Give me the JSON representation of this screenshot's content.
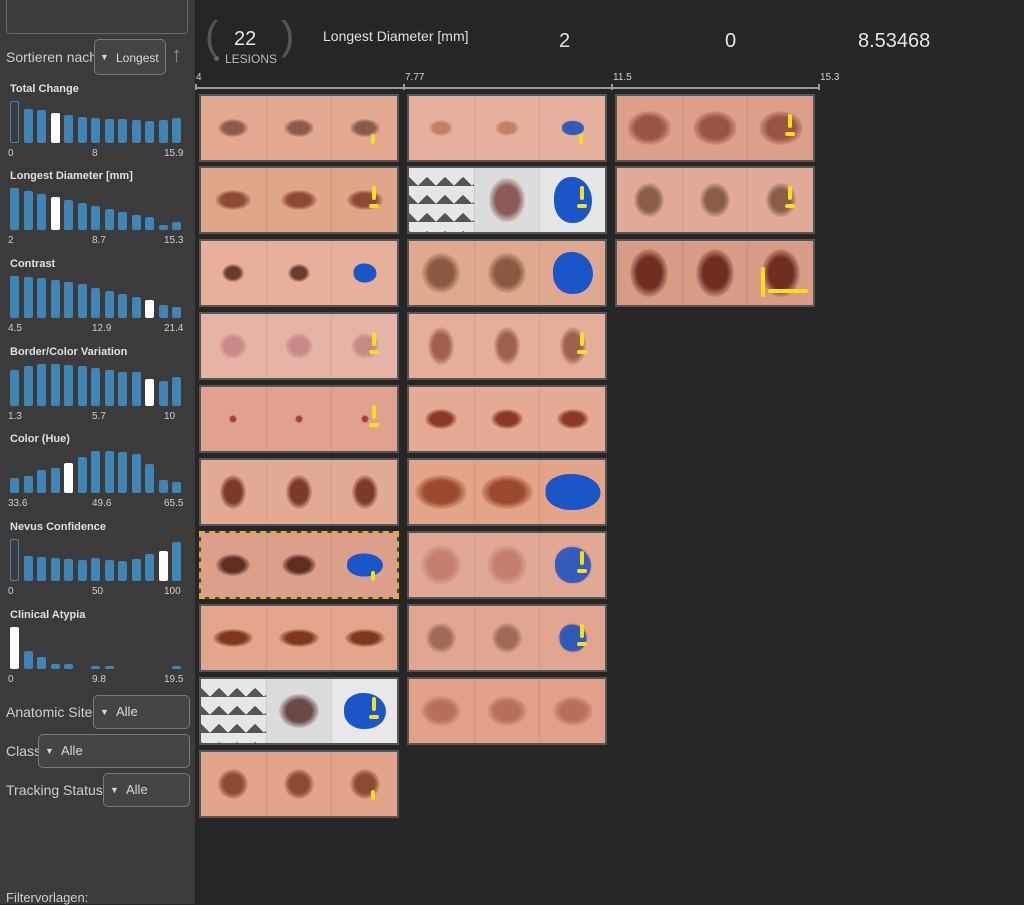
{
  "sidebar": {
    "sort_label": "Sortieren nach",
    "sort_value": "Longest",
    "sort_direction_icon": "arrow-up-icon",
    "histograms": [
      {
        "title": "Total Change",
        "ticks": [
          "0",
          "8",
          "15.9"
        ],
        "bars": [
          1.0,
          0.82,
          0.78,
          0.72,
          0.66,
          0.62,
          0.6,
          0.58,
          0.56,
          0.54,
          0.52,
          0.55,
          0.6
        ],
        "highlight": 3,
        "outline": 0
      },
      {
        "title": "Longest Diameter [mm]",
        "ticks": [
          "2",
          "8.7",
          "15.3"
        ],
        "bars": [
          1.0,
          0.92,
          0.85,
          0.78,
          0.72,
          0.65,
          0.58,
          0.5,
          0.42,
          0.35,
          0.3,
          0.12,
          0.18
        ],
        "highlight": 3,
        "outline": -1
      },
      {
        "title": "Contrast",
        "ticks": [
          "4.5",
          "12.9",
          "21.4"
        ],
        "bars": [
          1.0,
          0.98,
          0.95,
          0.9,
          0.85,
          0.8,
          0.72,
          0.65,
          0.58,
          0.5,
          0.42,
          0.32,
          0.25
        ],
        "highlight": 10,
        "outline": -1
      },
      {
        "title": "Border/Color Variation",
        "ticks": [
          "1.3",
          "5.7",
          "10"
        ],
        "bars": [
          0.85,
          0.95,
          1.0,
          1.0,
          0.98,
          0.95,
          0.9,
          0.85,
          0.82,
          0.8,
          0.65,
          0.6,
          0.7
        ],
        "highlight": 10,
        "outline": -1
      },
      {
        "title": "Color (Hue)",
        "ticks": [
          "33.6",
          "49.6",
          "65.5"
        ],
        "bars": [
          0.35,
          0.4,
          0.55,
          0.6,
          0.72,
          0.85,
          1.0,
          1.0,
          0.98,
          0.92,
          0.7,
          0.3,
          0.25
        ],
        "highlight": 4,
        "outline": -1
      },
      {
        "title": "Nevus Confidence",
        "ticks": [
          "0",
          "50",
          "100"
        ],
        "bars": [
          1.0,
          0.6,
          0.58,
          0.55,
          0.52,
          0.5,
          0.55,
          0.5,
          0.48,
          0.52,
          0.65,
          0.72,
          0.92
        ],
        "highlight": 11,
        "outline": 0
      },
      {
        "title": "Clinical Atypia",
        "ticks": [
          "0",
          "9.8",
          "19.5"
        ],
        "bars": [
          1.0,
          0.42,
          0.28,
          0.12,
          0.12,
          0.0,
          0.08,
          0.08,
          0.0,
          0.0,
          0.0,
          0.0,
          0.08
        ],
        "highlight": 0,
        "outline": -1
      }
    ],
    "filters": [
      {
        "label": "Anatomic Site",
        "value": "Alle"
      },
      {
        "label": "Class",
        "value": "Alle"
      },
      {
        "label": "Tracking Status",
        "value": "Alle"
      }
    ],
    "filtervorlagen_label": "Filtervorlagen:"
  },
  "header": {
    "lesion_count": "22",
    "lesion_label": "LESIONS",
    "attribute": "Longest Diameter [mm]",
    "numbers": [
      "2",
      "0",
      "8.53468"
    ],
    "axis_ticks": [
      "4",
      "7.77",
      "11.5",
      "15.3"
    ]
  },
  "colors": {
    "background": "#262626",
    "sidebar": "#3b3b3b",
    "bar": "#3f86b6",
    "highlight": "#ffffff",
    "segmentation": "#1a56c8",
    "boundary": "#f4e020",
    "selection": "#e0b020"
  },
  "grid": {
    "columns": [
      [
        {
          "skin": "#e3a890",
          "lesion": "#8a5a4a",
          "size": [
            30,
            18
          ],
          "seg": 0,
          "y": 1
        },
        {
          "skin": "#e0a68a",
          "lesion": "#8d4a34",
          "size": [
            36,
            20
          ],
          "seg": 0,
          "y": 2
        },
        {
          "skin": "#e8b09a",
          "lesion": "#6b3a2e",
          "size": [
            22,
            18
          ],
          "seg": 1,
          "y": 0
        },
        {
          "skin": "#e6b4a6",
          "lesion": "#c88a86",
          "size": [
            28,
            26
          ],
          "seg": 0,
          "y": 2
        },
        {
          "skin": "#e0a28e",
          "lesion": "#a04040",
          "size": [
            8,
            8
          ],
          "seg": 0,
          "y": 2
        },
        {
          "skin": "#e2aa92",
          "lesion": "#7a3a26",
          "size": [
            26,
            34
          ],
          "seg": 0,
          "y": 0
        },
        {
          "skin": "#dca08a",
          "lesion": "#5e2e22",
          "size": [
            34,
            22
          ],
          "seg": 1,
          "y": 1,
          "selected": true
        },
        {
          "skin": "#e3a68c",
          "lesion": "#7e3820",
          "size": [
            40,
            18
          ],
          "seg": 0,
          "y": 0
        },
        {
          "skin": "#e8e8e8",
          "lesion": "#6a4a48",
          "size": [
            40,
            34
          ],
          "seg": 1,
          "y": 2,
          "pattern": true
        },
        {
          "skin": "#e2a48a",
          "lesion": "#8a4a34",
          "size": [
            30,
            30
          ],
          "seg": 0,
          "y": 1
        }
      ],
      [
        {
          "skin": "#e6b09c",
          "lesion": "#c47e62",
          "size": [
            24,
            16
          ],
          "seg": 2,
          "y": 1
        },
        {
          "skin": "#e6e6e6",
          "lesion": "#8a5a5a",
          "size": [
            36,
            44
          ],
          "seg": 1,
          "y": 2,
          "pattern": true
        },
        {
          "skin": "#e0a88e",
          "lesion": "#8a5a40",
          "size": [
            38,
            40
          ],
          "seg": 1,
          "y": 0
        },
        {
          "skin": "#e4ae98",
          "lesion": "#a0604e",
          "size": [
            26,
            38
          ],
          "seg": 0,
          "y": 2
        },
        {
          "skin": "#e4aa94",
          "lesion": "#8a3a22",
          "size": [
            32,
            20
          ],
          "seg": 0,
          "y": 0
        },
        {
          "skin": "#e4a48a",
          "lesion": "#9a4a2e",
          "size": [
            52,
            34
          ],
          "seg": 1,
          "y": 0
        },
        {
          "skin": "#e2a896",
          "lesion": "#c4806e",
          "size": [
            40,
            40
          ],
          "seg": 2,
          "y": 2
        },
        {
          "skin": "#e0a690",
          "lesion": "#a06a58",
          "size": [
            30,
            30
          ],
          "seg": 2,
          "y": 2
        },
        {
          "skin": "#e2a088",
          "lesion": "#b8705a",
          "size": [
            40,
            30
          ],
          "seg": 0,
          "y": 0
        }
      ],
      [
        {
          "skin": "#dca08a",
          "lesion": "#9a5444",
          "size": [
            44,
            34
          ],
          "seg": 0,
          "y": 2
        },
        {
          "skin": "#e0aa96",
          "lesion": "#8a5e46",
          "size": [
            30,
            34
          ],
          "seg": 0,
          "y": 2
        },
        {
          "skin": "#d89c86",
          "lesion": "#6e2e22",
          "size": [
            38,
            48
          ],
          "seg": 0,
          "y": 3
        }
      ]
    ]
  }
}
